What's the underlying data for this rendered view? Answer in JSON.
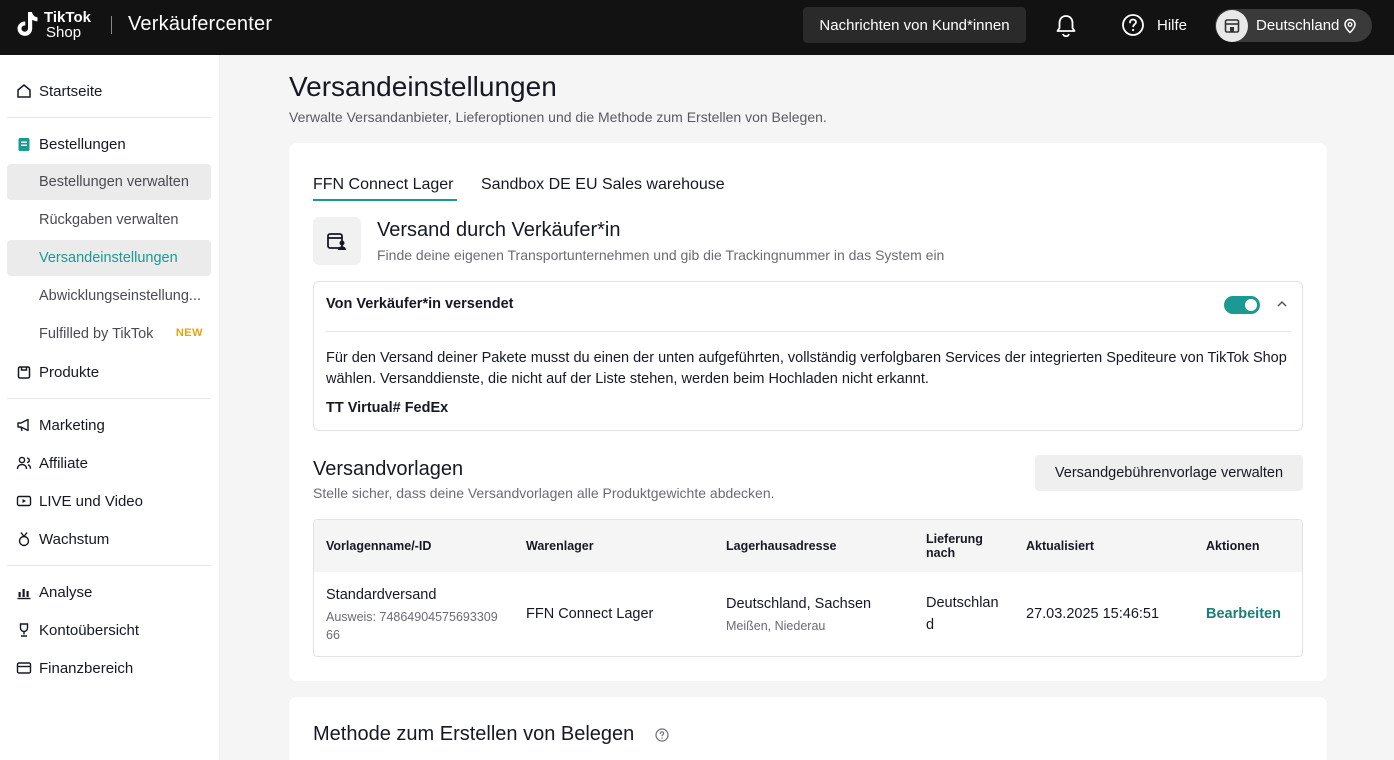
{
  "header": {
    "logo_line1": "TikTok",
    "logo_line2": "Shop",
    "app_title": "Verkäufercenter",
    "messages_button": "Nachrichten von Kund*innen",
    "help_label": "Hilfe",
    "country_label": "Deutschland"
  },
  "sidebar": {
    "items": [
      {
        "label": "Startseite",
        "icon": "home-icon"
      },
      {
        "label": "Bestellungen",
        "icon": "orders-icon"
      },
      {
        "label": "Bestellungen verwalten"
      },
      {
        "label": "Rückgaben verwalten"
      },
      {
        "label": "Versandeinstellungen"
      },
      {
        "label": "Abwicklungseinstellung..."
      },
      {
        "label": "Fulfilled by TikTok",
        "badge": "NEW"
      },
      {
        "label": "Produkte",
        "icon": "products-icon"
      },
      {
        "label": "Marketing",
        "icon": "megaphone-icon"
      },
      {
        "label": "Affiliate",
        "icon": "people-icon"
      },
      {
        "label": "LIVE und Video",
        "icon": "video-icon"
      },
      {
        "label": "Wachstum",
        "icon": "medal-icon"
      },
      {
        "label": "Analyse",
        "icon": "chart-icon"
      },
      {
        "label": "Kontoübersicht",
        "icon": "trophy-icon"
      },
      {
        "label": "Finanzbereich",
        "icon": "wallet-icon"
      }
    ]
  },
  "page": {
    "title": "Versandeinstellungen",
    "subtitle": "Verwalte Versandanbieter, Lieferoptionen und die Methode zum Erstellen von Belegen.",
    "tabs": [
      "FFN Connect Lager",
      "Sandbox DE EU Sales warehouse"
    ],
    "shipping": {
      "title": "Versand durch Verkäufer*in",
      "subtitle": "Finde deine eigenen Transportunternehmen und gib die Trackingnummer in das System ein",
      "panel_title": "Von Verkäufer*in versendet",
      "toggle_on": true,
      "panel_text": "Für den Versand deiner Pakete musst du einen der unten aufgeführten, vollständig verfolgbaren Services der integrierten Spediteure von TikTok Shop wählen. Versanddienste, die nicht auf der Liste stehen, werden beim Hochladen nicht erkannt.",
      "carriers": "TT Virtual# FedEx"
    },
    "templates": {
      "title": "Versandvorlagen",
      "subtitle": "Stelle sicher, dass deine Versandvorlagen alle Produktgewichte abdecken.",
      "manage_button": "Versandgebührenvorlage verwalten",
      "columns": [
        "Vorlagenname/-ID",
        "Warenlager",
        "Lagerhausadresse",
        "Lieferung nach",
        "Aktualisiert",
        "Aktionen"
      ],
      "rows": [
        {
          "name": "Standardversand",
          "id_line1": "Ausweis: 74864904575693309",
          "id_line2": "66",
          "warehouse": "FFN Connect Lager",
          "address": "Deutschland, Sachsen",
          "address_sub": "Meißen, Niederau",
          "delivery_line1": "Deutschlan",
          "delivery_line2": "d",
          "updated": "27.03.2025 15:46:51",
          "action": "Bearbeiten"
        }
      ]
    },
    "receipt_method_title": "Methode zum Erstellen von Belegen"
  },
  "colors": {
    "accent": "#1a9a92",
    "topbar": "#121212",
    "badge_new": "#e8a30c"
  }
}
